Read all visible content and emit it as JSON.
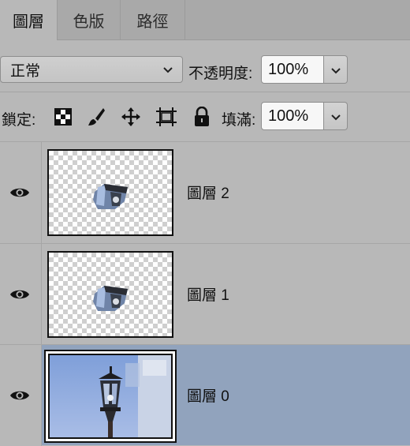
{
  "tabs": [
    {
      "label": "圖層",
      "active": true
    },
    {
      "label": "色版",
      "active": false
    },
    {
      "label": "路徑",
      "active": false
    }
  ],
  "blend": {
    "mode": "正常",
    "opacity_label": "不透明度:",
    "opacity_value": "100%"
  },
  "lock": {
    "label": "鎖定:",
    "icons": [
      "lock-transparent-pixels-icon",
      "lock-image-pixels-icon",
      "lock-position-icon",
      "lock-artboard-icon",
      "lock-all-icon"
    ],
    "fill_label": "填滿:",
    "fill_value": "100%"
  },
  "layers": [
    {
      "name": "圖層 2",
      "visible": true,
      "selected": false,
      "thumb": "transparent"
    },
    {
      "name": "圖層 1",
      "visible": true,
      "selected": false,
      "thumb": "transparent"
    },
    {
      "name": "圖層 0",
      "visible": true,
      "selected": true,
      "thumb": "photo"
    }
  ],
  "colors": {
    "panel": "#b8b8b8",
    "selected_row": "#91a3bd",
    "tab_bar": "#a9a9a9"
  }
}
